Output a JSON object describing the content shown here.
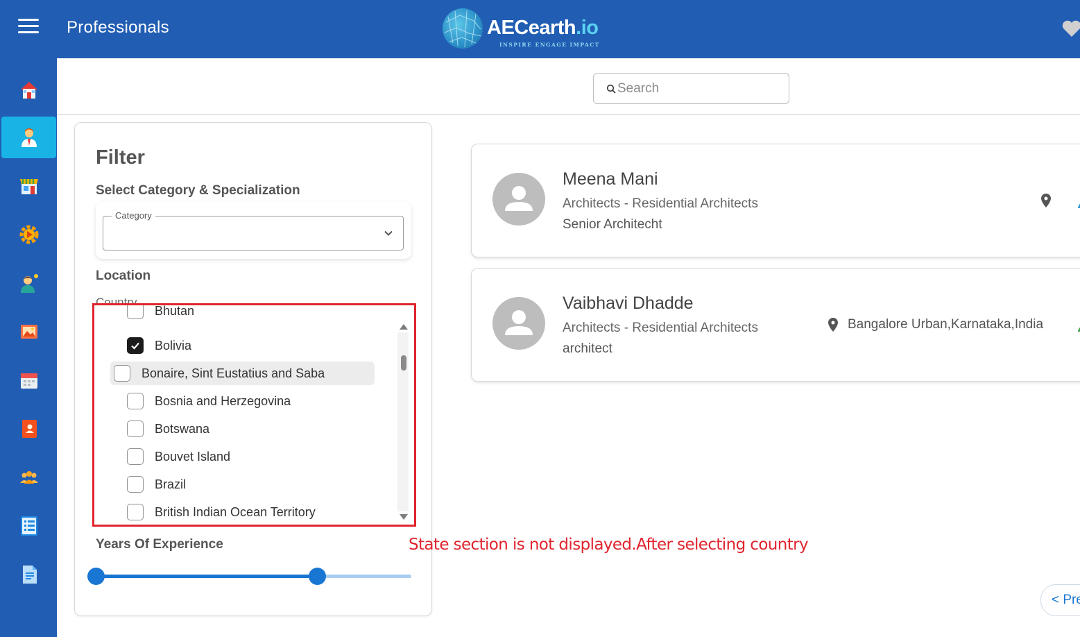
{
  "header": {
    "title": "Professionals",
    "logo_main": "AECearth",
    "logo_suffix": ".io",
    "logo_tagline": "INSPIRE ENGAGE IMPACT",
    "menu_icon": "hamburger-icon",
    "right_icon": "heart-icon"
  },
  "sidebar": {
    "items": [
      {
        "icon": "home-icon",
        "active": false
      },
      {
        "icon": "professional-icon",
        "active": true
      },
      {
        "icon": "store-icon",
        "active": false
      },
      {
        "icon": "gear-play-icon",
        "active": false
      },
      {
        "icon": "consultant-icon",
        "active": false
      },
      {
        "icon": "gallery-icon",
        "active": false
      },
      {
        "icon": "calendar-icon",
        "active": false
      },
      {
        "icon": "contact-book-icon",
        "active": false
      },
      {
        "icon": "group-icon",
        "active": false
      },
      {
        "icon": "list-icon",
        "active": false
      },
      {
        "icon": "document-icon",
        "active": false
      }
    ]
  },
  "search": {
    "placeholder": "Search",
    "value": ""
  },
  "filter": {
    "title": "Filter",
    "category_heading": "Select Category & Specialization",
    "category_label": "Category",
    "category_value": "",
    "location_heading": "Location",
    "country_label": "Country",
    "countries": [
      {
        "name": "Bhutan",
        "checked": false,
        "highlighted": false
      },
      {
        "name": "Bolivia",
        "checked": true,
        "highlighted": false
      },
      {
        "name": "Bonaire, Sint Eustatius and Saba",
        "checked": false,
        "highlighted": true
      },
      {
        "name": "Bosnia and Herzegovina",
        "checked": false,
        "highlighted": false
      },
      {
        "name": "Botswana",
        "checked": false,
        "highlighted": false
      },
      {
        "name": "Bouvet Island",
        "checked": false,
        "highlighted": false
      },
      {
        "name": "Brazil",
        "checked": false,
        "highlighted": false
      },
      {
        "name": "British Indian Ocean Territory",
        "checked": false,
        "highlighted": false
      }
    ],
    "experience_heading": "Years Of Experience",
    "experience_range": {
      "min_fraction": 0.0,
      "max_fraction": 0.7
    }
  },
  "professionals": [
    {
      "name": "Meena Mani",
      "category": "Architects - Residential Architects",
      "role": "Senior Architecht",
      "location": ""
    },
    {
      "name": "Vaibhavi Dhadde",
      "category": "Architects - Residential Architects",
      "role": "architect",
      "location": "Bangalore Urban,Karnataka,India"
    }
  ],
  "annotation": "State section is not displayed.After selecting country",
  "pagination": {
    "prev_label": "< Pre"
  },
  "colors": {
    "primary": "#215eb3",
    "active_nav": "#19b3e6",
    "accent": "#1976d2",
    "annotation_red": "#e0242e"
  }
}
